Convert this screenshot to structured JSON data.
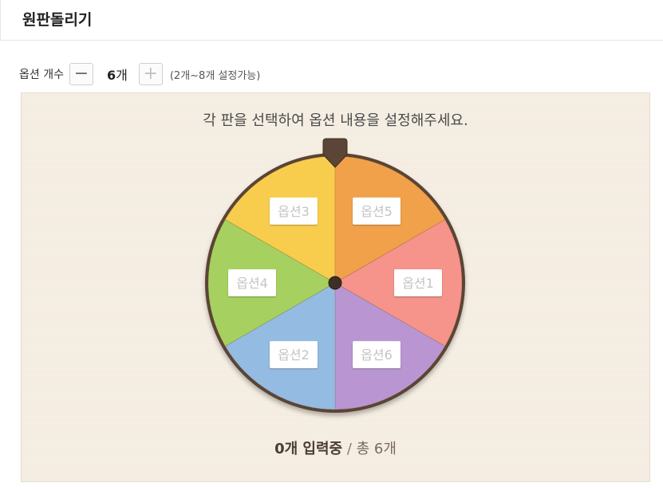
{
  "header": {
    "title": "원판돌리기"
  },
  "controls": {
    "label": "옵션 개수",
    "minus_symbol": "−",
    "count_number": "6",
    "count_unit": "개",
    "plus_symbol": "+",
    "range_hint": "(2개~8개 설정가능)"
  },
  "wheel": {
    "instruction": "각 판을 선택하여 옵션 내용을 설정해주세요.",
    "segments": [
      {
        "label": "옵션1",
        "color": "#f6938b"
      },
      {
        "label": "옵션6",
        "color": "#b996d2"
      },
      {
        "label": "옵션2",
        "color": "#94bbe2"
      },
      {
        "label": "옵션4",
        "color": "#a6d160"
      },
      {
        "label": "옵션3",
        "color": "#f8cd4d"
      },
      {
        "label": "옵션5",
        "color": "#f0a14a"
      }
    ],
    "rim_color": "#5a4536",
    "pointer_color": "#5a4536"
  },
  "status": {
    "entered": "0개 입력중",
    "separator": " / ",
    "total": "총 6개"
  }
}
